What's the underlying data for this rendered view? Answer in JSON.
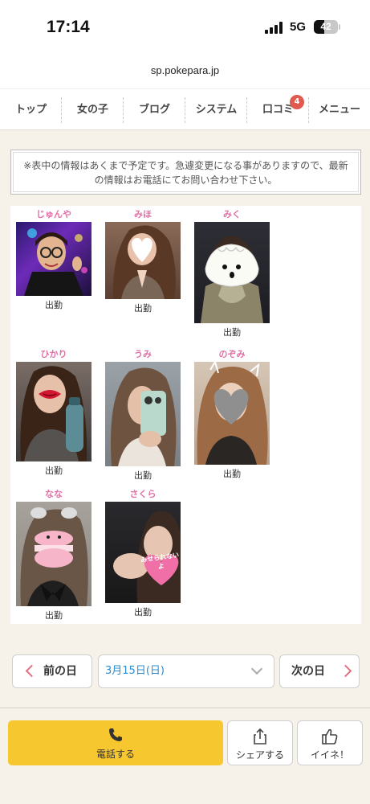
{
  "status_bar": {
    "time": "17:14",
    "network": "5G",
    "battery": "42",
    "battery_level": 0.42
  },
  "browser": {
    "url": "sp.pokepara.jp"
  },
  "nav": {
    "items": [
      {
        "label": "トップ"
      },
      {
        "label": "女の子"
      },
      {
        "label": "ブログ"
      },
      {
        "label": "システム"
      },
      {
        "label": "口コミ",
        "badge": "4"
      },
      {
        "label": "メニュー"
      }
    ]
  },
  "notice": {
    "text": "※表中の情報はあくまで予定です。急遽変更になる事がありますので、最新の情報はお電話にてお問い合わせ下さい。"
  },
  "girls": [
    {
      "name": "じゅんや",
      "status": "出勤"
    },
    {
      "name": "みほ",
      "status": "出勤"
    },
    {
      "name": "みく",
      "status": "出勤"
    },
    {
      "name": "ひかり",
      "status": "出勤"
    },
    {
      "name": "うみ",
      "status": "出勤"
    },
    {
      "name": "のぞみ",
      "status": "出勤"
    },
    {
      "name": "なな",
      "status": "出勤"
    },
    {
      "name": "さくら",
      "status": "出勤"
    }
  ],
  "sticker_text": "みせられないよ",
  "date_nav": {
    "prev_label": "前の日",
    "selected_date": "3月15日(日)",
    "next_label": "次の日"
  },
  "footer": {
    "call_label": "電話する",
    "share_label": "シェアする",
    "like_label": "イイネ！"
  },
  "colors": {
    "accent_pink": "#e070a5",
    "call_yellow": "#f7c72f",
    "badge_red": "#e05a50",
    "link_blue": "#2a8ccf"
  }
}
